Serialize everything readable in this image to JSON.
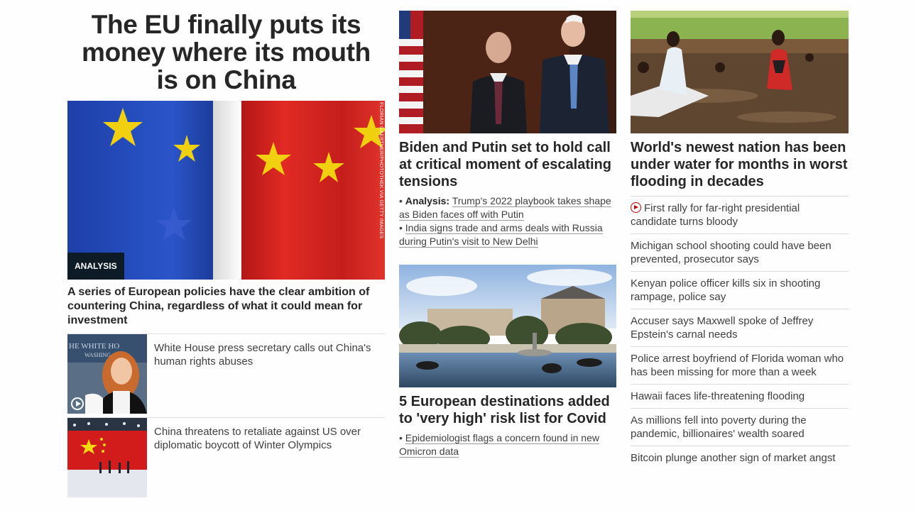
{
  "lead": {
    "title": "The EU finally puts its money where its mouth is on China",
    "image_credit": "FLORIAN GAERTNER/PHOTOTHEK VIA GETTY IMAGES",
    "badge": "ANALYSIS",
    "subhead": "A series of European policies have the clear ambition of countering China, regardless of what it could mean for investment"
  },
  "thumbs": [
    {
      "text": "White House press secretary calls out China's human rights abuses",
      "has_video": true,
      "icon": "play-icon"
    },
    {
      "text": "China threatens to retaliate against US over diplomatic boycott of Winter Olympics",
      "has_video": false
    }
  ],
  "story2": {
    "headline": "Biden and Putin set to hold call at critical moment of escalating tensions",
    "bullets": [
      {
        "prefix": "Analysis:",
        "text": "Trump's 2022 playbook takes shape as Biden faces off with Putin"
      },
      {
        "prefix": "",
        "text": "India signs trade and arms deals with Russia during Putin's visit to New Delhi"
      }
    ]
  },
  "story3": {
    "headline": "5 European destinations added to 'very high' risk list for Covid",
    "bullets": [
      {
        "prefix": "",
        "text": "Epidemiologist flags a concern found in new Omicron data"
      }
    ]
  },
  "story4": {
    "headline": "World's newest nation has been under water for months in worst flooding in decades"
  },
  "list": [
    {
      "text": "First rally for far-right presidential candidate turns bloody",
      "has_video": true
    },
    {
      "text": "Michigan school shooting could have been prevented, prosecutor says"
    },
    {
      "text": "Kenyan police officer kills six in shooting rampage, police say"
    },
    {
      "text": "Accuser says Maxwell spoke of Jeffrey Epstein's carnal needs"
    },
    {
      "text": "Police arrest boyfriend of Florida woman who has been missing for more than a week"
    },
    {
      "text": "Hawaii faces life-threatening flooding"
    },
    {
      "text": "As millions fell into poverty during the pandemic, billionaires' wealth soared"
    },
    {
      "text": "Bitcoin plunge another sign of market angst"
    }
  ],
  "colors": {
    "accent_red": "#cc0000",
    "badge_bg": "#0c1b26",
    "text": "#262626"
  }
}
